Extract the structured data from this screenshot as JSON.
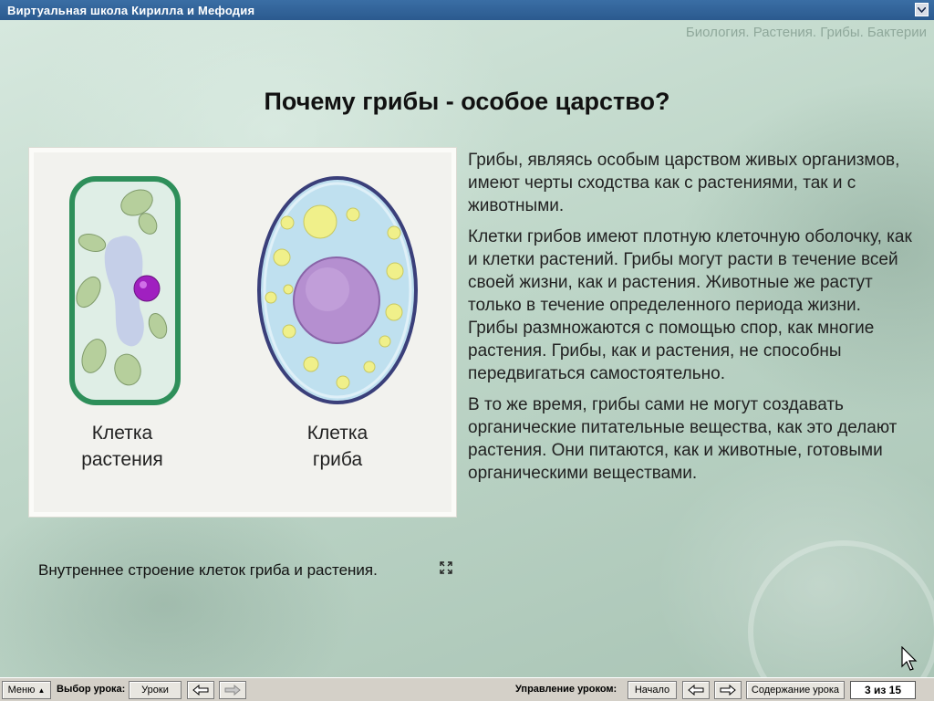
{
  "window": {
    "title": "Виртуальная школа Кирилла и Мефодия",
    "system_menu_icon": "chevron-down-icon"
  },
  "breadcrumb": "Биология. Растения. Грибы. Бактерии",
  "page": {
    "title": "Почему грибы - особое царство?",
    "figure": {
      "plant_cell_label_line1": "Клетка",
      "plant_cell_label_line2": "растения",
      "fungus_cell_label_line1": "Клетка",
      "fungus_cell_label_line2": "гриба",
      "colors": {
        "plant_wall": "#2e8f5a",
        "plant_cytoplasm": "#dfeee6",
        "chloroplast": "#b6cf9c",
        "vacuole": "#c2cbe8",
        "plant_nucleus": "#a020c0",
        "fungus_wall": "#3a3f7a",
        "fungus_cytoplasm": "#bfe0ef",
        "fungus_nucleus": "#b58fd0",
        "granule": "#f0f08a"
      }
    },
    "caption": "Внутреннее строение клеток гриба и растения.",
    "expand_icon": "expand-icon",
    "paragraphs": [
      "Грибы, являясь особым царством живых организмов, имеют черты сходства как с растениями, так и с животными.",
      "Клетки грибов имеют плотную клеточную оболочку, как и клетки растений. Грибы могут расти в течение всей своей жизни, как и растения. Животные же растут только в течение определенного периода жизни. Грибы размножаются с помощью спор, как многие растения. Грибы, как и растения, не способны передвигаться самостоятельно.",
      "В то же время, грибы сами не могут создавать органические питательные вещества, как это делают растения. Они питаются, как и животные, готовыми органическими веществами."
    ]
  },
  "toolbar": {
    "menu_label": "Меню",
    "lesson_select_label": "Выбор урока:",
    "lessons_button": "Уроки",
    "lesson_control_label": "Управление уроком:",
    "start_button": "Начало",
    "contents_button": "Содержание урока",
    "page_counter": "3 из 15"
  }
}
